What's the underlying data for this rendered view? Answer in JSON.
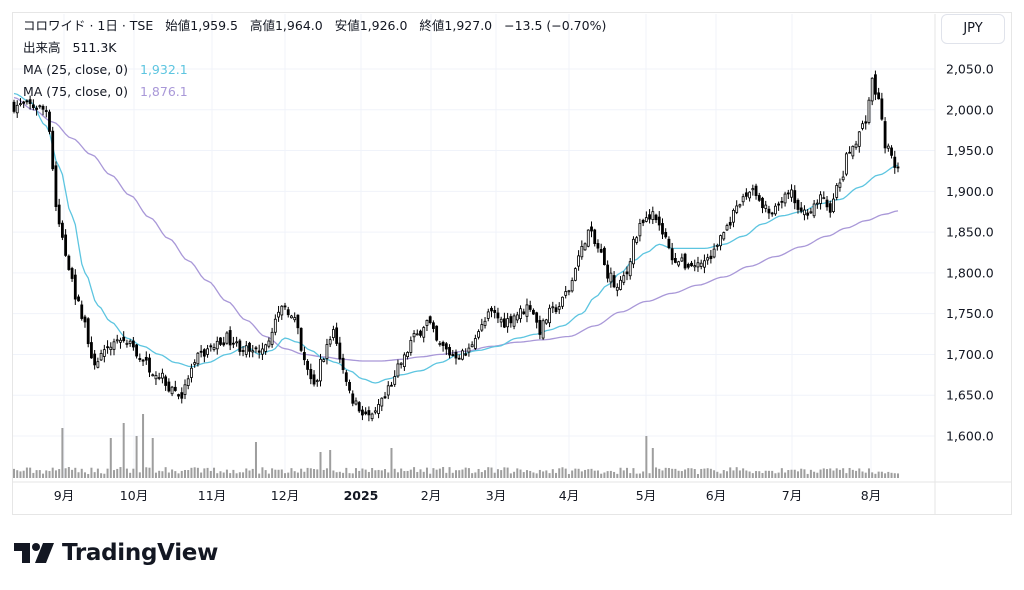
{
  "header": {
    "symbol": "コロワイド · 1日 · TSE",
    "open_label": "始値",
    "open": "1,959.5",
    "high_label": "高値",
    "high": "1,964.0",
    "low_label": "安値",
    "low": "1,926.0",
    "close_label": "終値",
    "close": "1,927.0",
    "change": "−13.5 (−0.70%)",
    "volume_label": "出来高",
    "volume": "511.3K",
    "ma25_label": "MA (25, close, 0)",
    "ma25_value": "1,932.1",
    "ma75_label": "MA (75, close, 0)",
    "ma75_value": "1,876.1"
  },
  "currency": "JPY",
  "brand": "TradingView",
  "colors": {
    "ma25": "#5dc5e0",
    "ma75": "#a998d8",
    "candle": "#000000",
    "volume": "#9e9e9e",
    "grid": "#f0f3fa"
  },
  "chart_data": {
    "type": "candlestick",
    "y_ticks": [
      "2,050.0",
      "2,000.0",
      "1,950.0",
      "1,900.0",
      "1,850.0",
      "1,800.0",
      "1,750.0",
      "1,700.0",
      "1,650.0",
      "1,600.0"
    ],
    "x_labels": [
      "9月",
      "10月",
      "11月",
      "12月",
      "2025",
      "2月",
      "3月",
      "4月",
      "5月",
      "6月",
      "7月",
      "8月"
    ],
    "ylim": [
      1590,
      2060
    ],
    "close_anchors": [
      [
        0,
        2005
      ],
      [
        5,
        2005
      ],
      [
        10,
        2000
      ],
      [
        14,
        1860
      ],
      [
        17,
        1810
      ],
      [
        20,
        1760
      ],
      [
        22,
        1740
      ],
      [
        24,
        1690
      ],
      [
        28,
        1700
      ],
      [
        32,
        1720
      ],
      [
        36,
        1710
      ],
      [
        40,
        1690
      ],
      [
        44,
        1680
      ],
      [
        48,
        1660
      ],
      [
        52,
        1650
      ],
      [
        55,
        1680
      ],
      [
        58,
        1700
      ],
      [
        62,
        1710
      ],
      [
        66,
        1720
      ],
      [
        70,
        1710
      ],
      [
        74,
        1700
      ],
      [
        78,
        1715
      ],
      [
        81,
        1740
      ],
      [
        84,
        1760
      ],
      [
        87,
        1740
      ],
      [
        90,
        1690
      ],
      [
        93,
        1660
      ],
      [
        96,
        1700
      ],
      [
        99,
        1730
      ],
      [
        102,
        1680
      ],
      [
        105,
        1645
      ],
      [
        108,
        1630
      ],
      [
        111,
        1620
      ],
      [
        114,
        1640
      ],
      [
        117,
        1660
      ],
      [
        120,
        1690
      ],
      [
        124,
        1720
      ],
      [
        128,
        1740
      ],
      [
        132,
        1710
      ],
      [
        136,
        1700
      ],
      [
        140,
        1700
      ],
      [
        144,
        1730
      ],
      [
        148,
        1750
      ],
      [
        152,
        1740
      ],
      [
        156,
        1750
      ],
      [
        160,
        1760
      ],
      [
        163,
        1730
      ],
      [
        166,
        1750
      ],
      [
        169,
        1760
      ],
      [
        172,
        1780
      ],
      [
        175,
        1820
      ],
      [
        178,
        1850
      ],
      [
        181,
        1830
      ],
      [
        184,
        1800
      ],
      [
        187,
        1780
      ],
      [
        190,
        1800
      ],
      [
        192,
        1840
      ],
      [
        195,
        1860
      ],
      [
        198,
        1875
      ],
      [
        201,
        1850
      ],
      [
        204,
        1820
      ],
      [
        208,
        1810
      ],
      [
        212,
        1810
      ],
      [
        216,
        1820
      ],
      [
        220,
        1850
      ],
      [
        223,
        1870
      ],
      [
        226,
        1890
      ],
      [
        229,
        1905
      ],
      [
        232,
        1880
      ],
      [
        235,
        1870
      ],
      [
        238,
        1890
      ],
      [
        241,
        1895
      ],
      [
        244,
        1870
      ],
      [
        247,
        1880
      ],
      [
        250,
        1890
      ],
      [
        253,
        1880
      ],
      [
        256,
        1910
      ],
      [
        259,
        1950
      ],
      [
        262,
        1970
      ],
      [
        264,
        1990
      ],
      [
        266,
        2035
      ],
      [
        268,
        2010
      ],
      [
        270,
        1960
      ],
      [
        272,
        1940
      ],
      [
        274,
        1927
      ]
    ],
    "ma25_anchors": [
      [
        0,
        2020
      ],
      [
        5,
        2010
      ],
      [
        10,
        1980
      ],
      [
        14,
        1930
      ],
      [
        18,
        1870
      ],
      [
        22,
        1800
      ],
      [
        26,
        1760
      ],
      [
        30,
        1740
      ],
      [
        35,
        1720
      ],
      [
        40,
        1710
      ],
      [
        45,
        1700
      ],
      [
        50,
        1690
      ],
      [
        55,
        1685
      ],
      [
        60,
        1690
      ],
      [
        66,
        1700
      ],
      [
        72,
        1710
      ],
      [
        76,
        1700
      ],
      [
        80,
        1705
      ],
      [
        84,
        1720
      ],
      [
        88,
        1715
      ],
      [
        92,
        1705
      ],
      [
        96,
        1695
      ],
      [
        100,
        1690
      ],
      [
        104,
        1680
      ],
      [
        108,
        1670
      ],
      [
        112,
        1665
      ],
      [
        116,
        1670
      ],
      [
        120,
        1675
      ],
      [
        126,
        1680
      ],
      [
        132,
        1690
      ],
      [
        138,
        1700
      ],
      [
        144,
        1705
      ],
      [
        150,
        1710
      ],
      [
        156,
        1720
      ],
      [
        162,
        1725
      ],
      [
        166,
        1730
      ],
      [
        170,
        1735
      ],
      [
        176,
        1750
      ],
      [
        180,
        1770
      ],
      [
        184,
        1785
      ],
      [
        188,
        1800
      ],
      [
        192,
        1815
      ],
      [
        196,
        1825
      ],
      [
        200,
        1835
      ],
      [
        204,
        1830
      ],
      [
        208,
        1830
      ],
      [
        214,
        1830
      ],
      [
        220,
        1835
      ],
      [
        226,
        1845
      ],
      [
        232,
        1860
      ],
      [
        238,
        1870
      ],
      [
        244,
        1875
      ],
      [
        250,
        1885
      ],
      [
        256,
        1890
      ],
      [
        262,
        1905
      ],
      [
        268,
        1920
      ],
      [
        274,
        1932
      ]
    ],
    "ma75_anchors": [
      [
        0,
        2015
      ],
      [
        6,
        2000
      ],
      [
        12,
        1985
      ],
      [
        18,
        1965
      ],
      [
        24,
        1945
      ],
      [
        30,
        1920
      ],
      [
        36,
        1895
      ],
      [
        42,
        1868
      ],
      [
        48,
        1842
      ],
      [
        54,
        1815
      ],
      [
        60,
        1790
      ],
      [
        66,
        1765
      ],
      [
        72,
        1742
      ],
      [
        78,
        1722
      ],
      [
        84,
        1707
      ],
      [
        90,
        1700
      ],
      [
        96,
        1697
      ],
      [
        102,
        1694
      ],
      [
        108,
        1692
      ],
      [
        114,
        1692
      ],
      [
        120,
        1694
      ],
      [
        126,
        1697
      ],
      [
        132,
        1700
      ],
      [
        140,
        1704
      ],
      [
        148,
        1710
      ],
      [
        156,
        1715
      ],
      [
        164,
        1718
      ],
      [
        172,
        1722
      ],
      [
        180,
        1735
      ],
      [
        188,
        1752
      ],
      [
        196,
        1765
      ],
      [
        204,
        1775
      ],
      [
        212,
        1785
      ],
      [
        220,
        1795
      ],
      [
        228,
        1808
      ],
      [
        236,
        1820
      ],
      [
        244,
        1832
      ],
      [
        252,
        1845
      ],
      [
        258,
        1855
      ],
      [
        264,
        1864
      ],
      [
        270,
        1872
      ],
      [
        274,
        1876
      ]
    ]
  }
}
